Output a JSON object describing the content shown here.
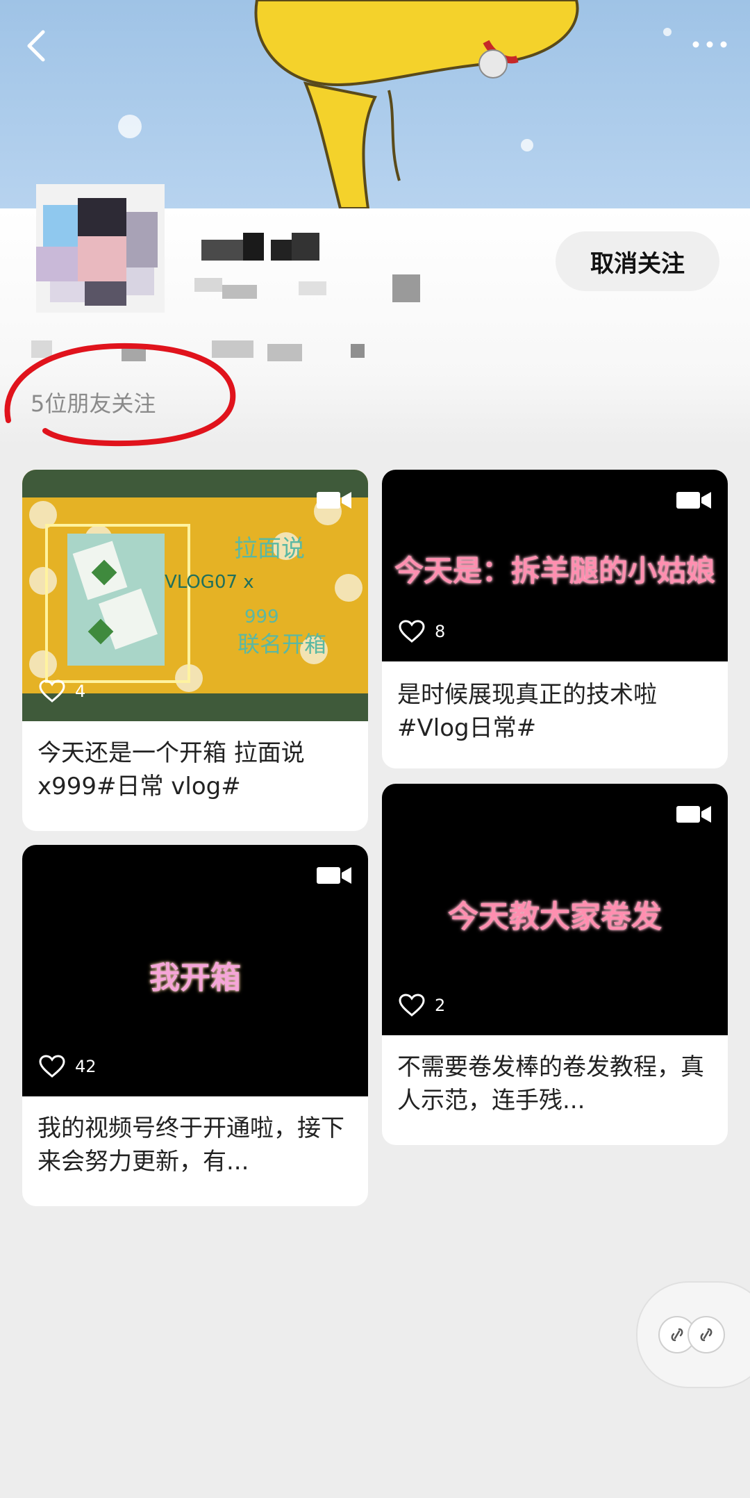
{
  "header": {
    "back_icon": "chevron-left-icon",
    "more_icon": "ellipsis-icon"
  },
  "profile": {
    "unfollow_label": "取消关注",
    "friends_following": "5位朋友关注"
  },
  "videos": [
    {
      "likes": "4",
      "caption": "今天还是一个开箱 拉面说x999#日常 vlog#",
      "overlay": "拉面说 VLOG07 x 999 联名开箱"
    },
    {
      "likes": "8",
      "caption": "是时候展现真正的技术啦#Vlog日常#",
      "overlay": "今天是：拆羊腿的小姑娘"
    },
    {
      "likes": "42",
      "caption": "我的视频号终于开通啦，接下来会努力更新，有...",
      "overlay": "我开箱"
    },
    {
      "likes": "2",
      "caption": "不需要卷发棒的卷发教程，真人示范，连手残...",
      "overlay": "今天教大家卷发"
    }
  ],
  "colors": {
    "cover_sky": "#b7d3ef",
    "page_bg": "#ededed",
    "overlay_pink": "#ff8fb0",
    "annotation_red": "#e0131c"
  }
}
